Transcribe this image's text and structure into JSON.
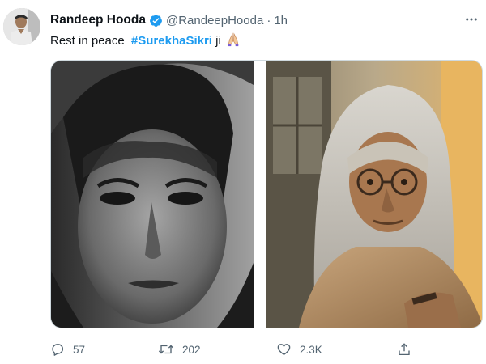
{
  "tweet": {
    "author": {
      "name": "Randeep Hooda",
      "handle": "@RandeepHooda",
      "verified": true,
      "avatar_icon": "avatar-photo"
    },
    "separator": "·",
    "time": "1h",
    "text_prefix": "Rest in peace",
    "hashtag": "#SurekhaSikri",
    "text_suffix": " ji",
    "emoji": "folded-hands",
    "media": [
      {
        "icon": "bw-portrait-photo"
      },
      {
        "icon": "color-film-still-photo"
      }
    ]
  },
  "actions": {
    "reply": {
      "icon": "reply-icon",
      "count": "57"
    },
    "retweet": {
      "icon": "retweet-icon",
      "count": "202"
    },
    "like": {
      "icon": "like-icon",
      "count": "2.3K"
    },
    "share": {
      "icon": "share-icon"
    }
  },
  "colors": {
    "text_primary": "#0f1419",
    "text_secondary": "#536471",
    "accent": "#1d9bf0",
    "border": "#cfd9de"
  }
}
